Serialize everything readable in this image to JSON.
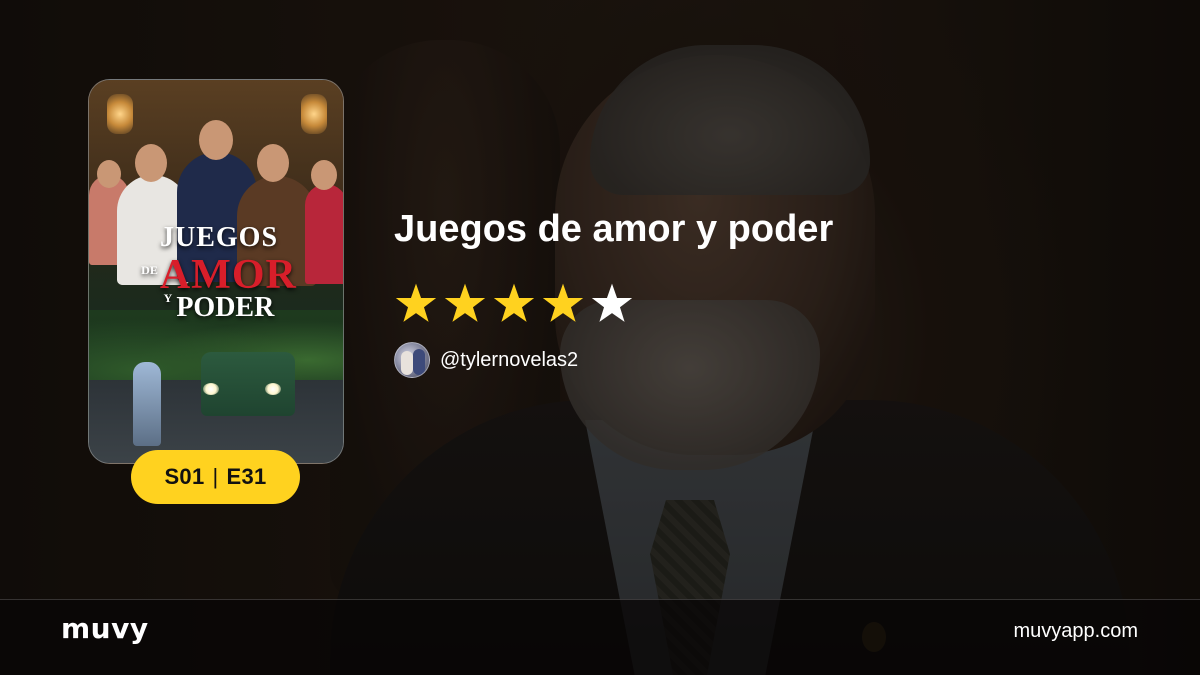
{
  "show": {
    "title": "Juegos de amor y poder",
    "rating": 4,
    "rating_max": 5,
    "episode": {
      "season": "S01",
      "separator": "|",
      "number": "E31"
    },
    "poster": {
      "title_line1": "JUEGOS",
      "title_de": "DE",
      "title_amor": "AMOR",
      "title_y": "Y",
      "title_poder": "PODER"
    }
  },
  "user": {
    "handle": "@tylernovelas2"
  },
  "footer": {
    "logo": "muvy",
    "site": "muvyapp.com"
  },
  "colors": {
    "accent": "#ffd21f",
    "star_filled": "#ffd21f",
    "star_empty": "#ffffff",
    "amor_red": "#d81e2a"
  },
  "icons": {
    "star": "star-icon",
    "avatar": "user-avatar"
  }
}
